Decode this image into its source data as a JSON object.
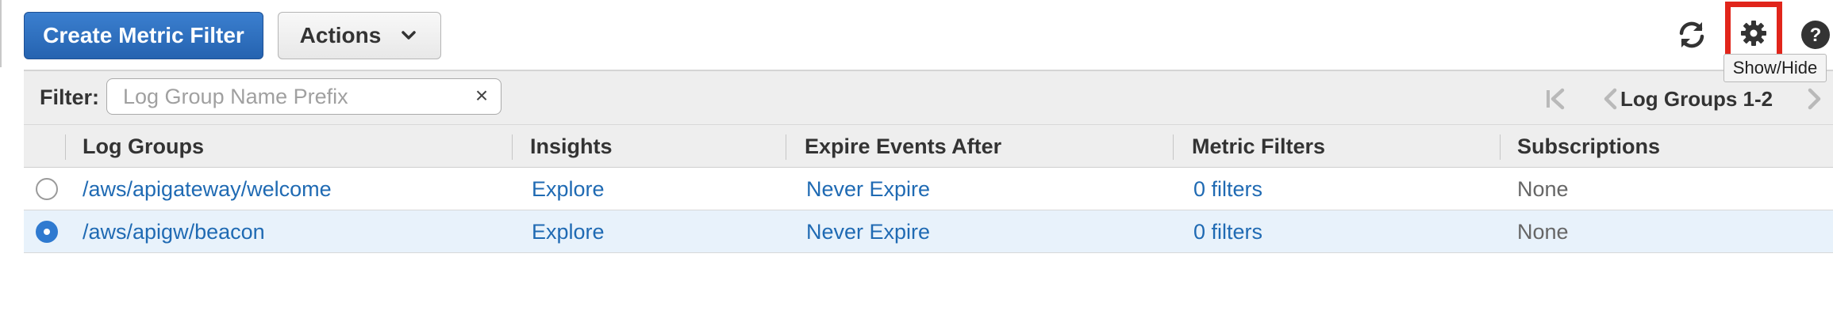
{
  "toolbar": {
    "create_label": "Create Metric Filter",
    "actions_label": "Actions",
    "tooltip": "Show/Hide"
  },
  "filter": {
    "label": "Filter:",
    "placeholder": "Log Group Name Prefix",
    "clear": "×"
  },
  "pager": {
    "label": "Log Groups 1-2"
  },
  "table": {
    "columns": [
      "Log Groups",
      "Insights",
      "Expire Events After",
      "Metric Filters",
      "Subscriptions"
    ],
    "rows": [
      {
        "selected": false,
        "log_group": "/aws/apigateway/welcome",
        "insights": "Explore",
        "expire": "Never Expire",
        "metric_filters": "0 filters",
        "subscriptions": "None"
      },
      {
        "selected": true,
        "log_group": "/aws/apigw/beacon",
        "insights": "Explore",
        "expire": "Never Expire",
        "metric_filters": "0 filters",
        "subscriptions": "None"
      }
    ]
  },
  "icons": {
    "refresh": "refresh-icon",
    "settings": "gear-icon",
    "help": "help-icon",
    "actions_chevron": "chevron-down-icon",
    "pager_first": "first-page-icon",
    "pager_prev": "prev-page-icon",
    "pager_next": "next-page-icon"
  },
  "colors": {
    "primary": "#2563b0",
    "link": "#1f6ab3",
    "highlight": "#e1251b",
    "selected_row": "#e8f2fb"
  }
}
